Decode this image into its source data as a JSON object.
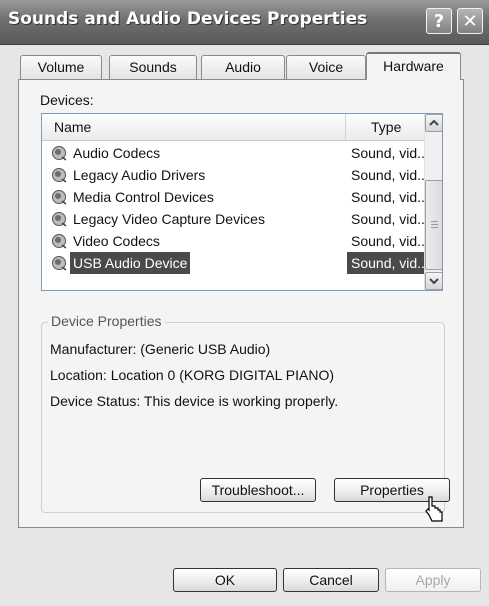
{
  "window": {
    "title": "Sounds and Audio Devices Properties",
    "help_icon": "help-icon",
    "close_icon": "close-icon"
  },
  "tabs": [
    {
      "label": "Volume"
    },
    {
      "label": "Sounds"
    },
    {
      "label": "Audio"
    },
    {
      "label": "Voice"
    },
    {
      "label": "Hardware",
      "active": true
    }
  ],
  "devices": {
    "label": "Devices:",
    "columns": {
      "name": "Name",
      "type": "Type"
    },
    "rows": [
      {
        "name": "Audio Codecs",
        "type": "Sound, vid..."
      },
      {
        "name": "Legacy Audio Drivers",
        "type": "Sound, vid..."
      },
      {
        "name": "Media Control Devices",
        "type": "Sound, vid..."
      },
      {
        "name": "Legacy Video Capture Devices",
        "type": "Sound, vid..."
      },
      {
        "name": "Video Codecs",
        "type": "Sound, vid..."
      },
      {
        "name": "USB Audio Device",
        "type": "Sound, vid...",
        "selected": true
      }
    ],
    "row_icon": "speaker-icon"
  },
  "device_properties": {
    "title": "Device Properties",
    "manufacturer": "Manufacturer: (Generic USB Audio)",
    "location": "Location: Location 0 (KORG DIGITAL PIANO)",
    "status": "Device Status: This device is working properly.",
    "troubleshoot_label": "Troubleshoot...",
    "properties_label": "Properties"
  },
  "footer": {
    "ok_label": "OK",
    "cancel_label": "Cancel",
    "apply_label": "Apply"
  }
}
